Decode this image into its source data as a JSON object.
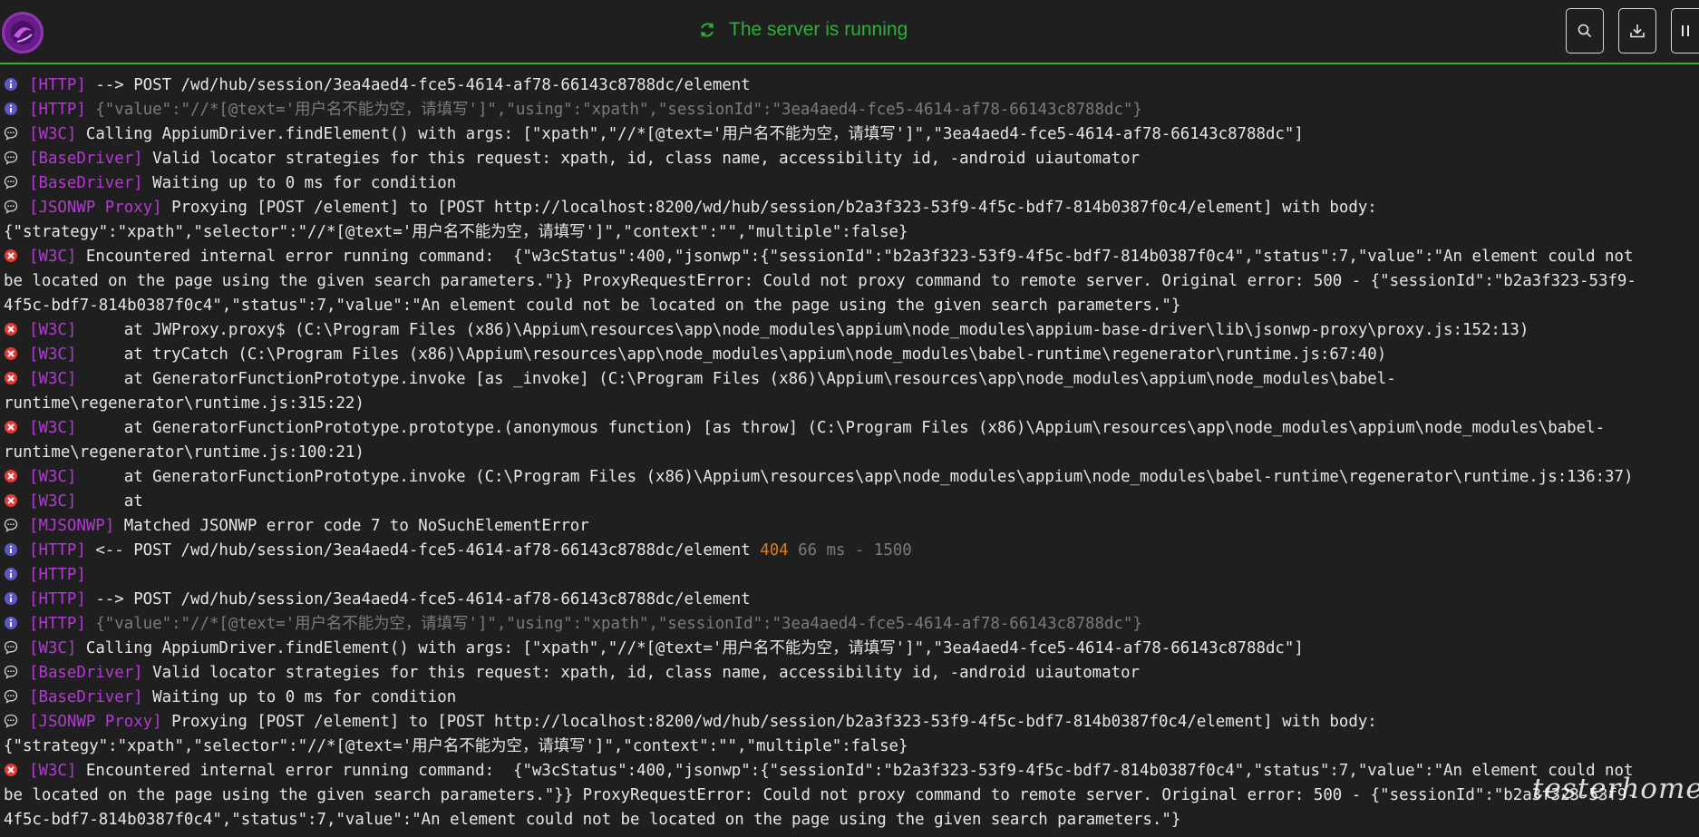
{
  "header": {
    "status_text": "The server is running",
    "status_color": "#2fae3a",
    "buttons": [
      "search-icon",
      "download-icon",
      "pause-icon"
    ]
  },
  "colors": {
    "tag": "#b13bd1",
    "info_icon": "#5b57c7",
    "error_icon": "#e53935",
    "status_404": "#e07a1f"
  },
  "log": [
    {
      "icon": "info",
      "tag": "[HTTP]",
      "text": "--> POST /wd/hub/session/3ea4aed4-fce5-4614-af78-66143c8788dc/element"
    },
    {
      "icon": "info",
      "tag": "[HTTP]",
      "dim": "{\"value\":\"//*[@text='用户名不能为空，请填写']\",\"using\":\"xpath\",\"sessionId\":\"3ea4aed4-fce5-4614-af78-66143c8788dc\"}"
    },
    {
      "icon": "chat",
      "tag": "[W3C]",
      "text": "Calling AppiumDriver.findElement() with args: [\"xpath\",\"//*[@text='用户名不能为空，请填写']\",\"3ea4aed4-fce5-4614-af78-66143c8788dc\"]"
    },
    {
      "icon": "chat",
      "tag": "[BaseDriver]",
      "text": "Valid locator strategies for this request: xpath, id, class name, accessibility id, -android uiautomator"
    },
    {
      "icon": "chat",
      "tag": "[BaseDriver]",
      "text": "Waiting up to 0 ms for condition"
    },
    {
      "icon": "chat",
      "tag": "[JSONWP Proxy]",
      "text": "Proxying [POST /element] to [POST http://localhost:8200/wd/hub/session/b2a3f323-53f9-4f5c-bdf7-814b0387f0c4/element] with body:"
    },
    {
      "icon": "",
      "tag": "",
      "text": "{\"strategy\":\"xpath\",\"selector\":\"//*[@text='用户名不能为空，请填写']\",\"context\":\"\",\"multiple\":false}"
    },
    {
      "icon": "error",
      "tag": "[W3C]",
      "text": "Encountered internal error running command:  {\"w3cStatus\":400,\"jsonwp\":{\"sessionId\":\"b2a3f323-53f9-4f5c-bdf7-814b0387f0c4\",\"status\":7,\"value\":\"An element could not"
    },
    {
      "icon": "",
      "tag": "",
      "text": "be located on the page using the given search parameters.\"}} ProxyRequestError: Could not proxy command to remote server. Original error: 500 - {\"sessionId\":\"b2a3f323-53f9-"
    },
    {
      "icon": "",
      "tag": "",
      "text": "4f5c-bdf7-814b0387f0c4\",\"status\":7,\"value\":\"An element could not be located on the page using the given search parameters.\"}"
    },
    {
      "icon": "error",
      "tag": "[W3C]",
      "text": "    at JWProxy.proxy$ (C:\\Program Files (x86)\\Appium\\resources\\app\\node_modules\\appium\\node_modules\\appium-base-driver\\lib\\jsonwp-proxy\\proxy.js:152:13)"
    },
    {
      "icon": "error",
      "tag": "[W3C]",
      "text": "    at tryCatch (C:\\Program Files (x86)\\Appium\\resources\\app\\node_modules\\appium\\node_modules\\babel-runtime\\regenerator\\runtime.js:67:40)"
    },
    {
      "icon": "error",
      "tag": "[W3C]",
      "text": "    at GeneratorFunctionPrototype.invoke [as _invoke] (C:\\Program Files (x86)\\Appium\\resources\\app\\node_modules\\appium\\node_modules\\babel-"
    },
    {
      "icon": "",
      "tag": "",
      "text": "runtime\\regenerator\\runtime.js:315:22)"
    },
    {
      "icon": "error",
      "tag": "[W3C]",
      "text": "    at GeneratorFunctionPrototype.prototype.(anonymous function) [as throw] (C:\\Program Files (x86)\\Appium\\resources\\app\\node_modules\\appium\\node_modules\\babel-"
    },
    {
      "icon": "",
      "tag": "",
      "text": "runtime\\regenerator\\runtime.js:100:21)"
    },
    {
      "icon": "error",
      "tag": "[W3C]",
      "text": "    at GeneratorFunctionPrototype.invoke (C:\\Program Files (x86)\\Appium\\resources\\app\\node_modules\\appium\\node_modules\\babel-runtime\\regenerator\\runtime.js:136:37)"
    },
    {
      "icon": "error",
      "tag": "[W3C]",
      "text": "    at"
    },
    {
      "icon": "chat",
      "tag": "[MJSONWP]",
      "text": "Matched JSONWP error code 7 to NoSuchElementError"
    },
    {
      "icon": "info",
      "tag": "[HTTP]",
      "text": "<-- POST /wd/hub/session/3ea4aed4-fce5-4614-af78-66143c8788dc/element ",
      "status": "404",
      "dim": " 66 ms - 1500"
    },
    {
      "icon": "info",
      "tag": "[HTTP]",
      "text": ""
    },
    {
      "icon": "info",
      "tag": "[HTTP]",
      "text": "--> POST /wd/hub/session/3ea4aed4-fce5-4614-af78-66143c8788dc/element"
    },
    {
      "icon": "info",
      "tag": "[HTTP]",
      "dim": "{\"value\":\"//*[@text='用户名不能为空，请填写']\",\"using\":\"xpath\",\"sessionId\":\"3ea4aed4-fce5-4614-af78-66143c8788dc\"}"
    },
    {
      "icon": "chat",
      "tag": "[W3C]",
      "text": "Calling AppiumDriver.findElement() with args: [\"xpath\",\"//*[@text='用户名不能为空，请填写']\",\"3ea4aed4-fce5-4614-af78-66143c8788dc\"]"
    },
    {
      "icon": "chat",
      "tag": "[BaseDriver]",
      "text": "Valid locator strategies for this request: xpath, id, class name, accessibility id, -android uiautomator"
    },
    {
      "icon": "chat",
      "tag": "[BaseDriver]",
      "text": "Waiting up to 0 ms for condition"
    },
    {
      "icon": "chat",
      "tag": "[JSONWP Proxy]",
      "text": "Proxying [POST /element] to [POST http://localhost:8200/wd/hub/session/b2a3f323-53f9-4f5c-bdf7-814b0387f0c4/element] with body:"
    },
    {
      "icon": "",
      "tag": "",
      "text": "{\"strategy\":\"xpath\",\"selector\":\"//*[@text='用户名不能为空，请填写']\",\"context\":\"\",\"multiple\":false}"
    },
    {
      "icon": "error",
      "tag": "[W3C]",
      "text": "Encountered internal error running command:  {\"w3cStatus\":400,\"jsonwp\":{\"sessionId\":\"b2a3f323-53f9-4f5c-bdf7-814b0387f0c4\",\"status\":7,\"value\":\"An element could not"
    },
    {
      "icon": "",
      "tag": "",
      "text": "be located on the page using the given search parameters.\"}} ProxyRequestError: Could not proxy command to remote server. Original error: 500 - {\"sessionId\":\"b2a3f323-53f9-"
    },
    {
      "icon": "",
      "tag": "",
      "text": "4f5c-bdf7-814b0387f0c4\",\"status\":7,\"value\":\"An element could not be located on the page using the given search parameters.\"}"
    }
  ],
  "watermark": "testerhome.com"
}
